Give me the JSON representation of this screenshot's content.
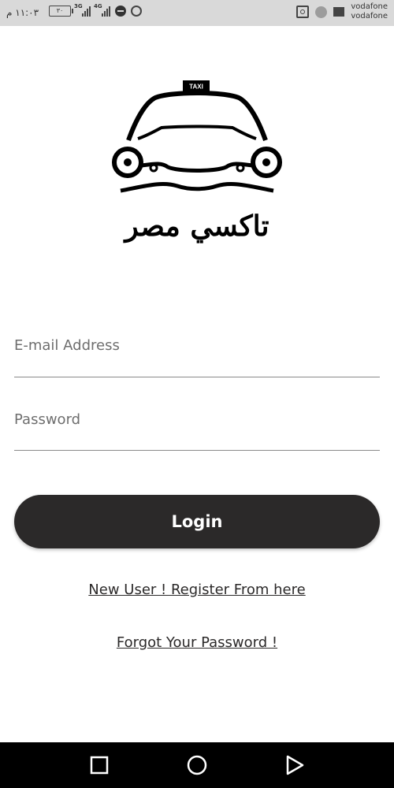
{
  "status_bar": {
    "time": "١١:٠٣ م",
    "battery": "٣٠",
    "signal1_label": "3G",
    "signal2_label": "4G",
    "carrier_top": "vodafone",
    "carrier_bottom": "vodafone"
  },
  "logo": {
    "taxi_sign": "TAXI",
    "brand_arabic": "تاكسي مصر"
  },
  "form": {
    "email_placeholder": "E-mail Address",
    "password_placeholder": "Password",
    "login_label": "Login"
  },
  "links": {
    "register": "New User ! Register From here",
    "forgot": "Forgot Your Password !"
  },
  "colors": {
    "primary_button": "#2b2929",
    "background": "#ffffff",
    "status_bar": "#d9d9d9",
    "nav_bar": "#000000"
  },
  "nav_icons": [
    "recent-apps-icon",
    "home-icon",
    "back-icon"
  ]
}
